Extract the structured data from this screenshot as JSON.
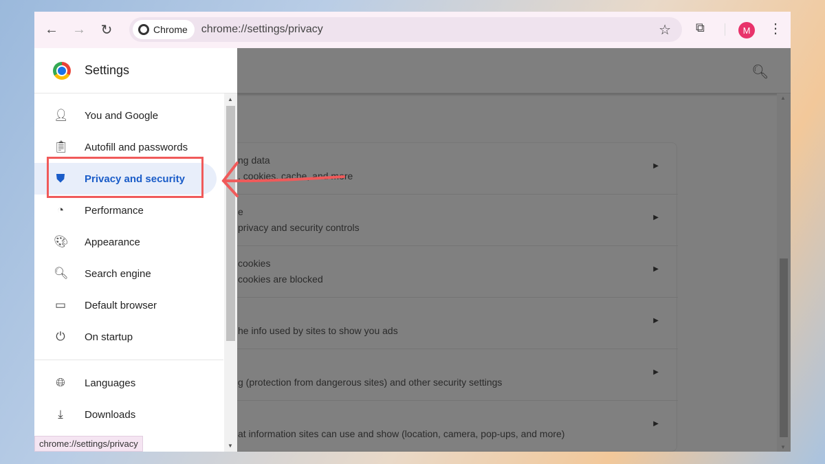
{
  "browser": {
    "chip_label": "Chrome",
    "url": "chrome://settings/privacy",
    "avatar_letter": "M",
    "status_url": "chrome://settings/privacy"
  },
  "sidebar": {
    "title": "Settings",
    "items": [
      {
        "label": "You and Google",
        "icon": "person-icon"
      },
      {
        "label": "Autofill and passwords",
        "icon": "clipboard-icon"
      },
      {
        "label": "Privacy and security",
        "icon": "shield-icon",
        "active": true
      },
      {
        "label": "Performance",
        "icon": "speedometer-icon"
      },
      {
        "label": "Appearance",
        "icon": "palette-icon"
      },
      {
        "label": "Search engine",
        "icon": "search-icon"
      },
      {
        "label": "Default browser",
        "icon": "browser-icon"
      },
      {
        "label": "On startup",
        "icon": "power-icon"
      },
      {
        "label": "Languages",
        "icon": "globe-icon"
      },
      {
        "label": "Downloads",
        "icon": "download-icon"
      }
    ]
  },
  "main": {
    "rows": [
      {
        "title": "ng data",
        "subtitle": ", cookies, cache, and more"
      },
      {
        "title": "e",
        "subtitle": "privacy and security controls"
      },
      {
        "title": "cookies",
        "subtitle": "cookies are blocked"
      },
      {
        "title": "",
        "subtitle": "he info used by sites to show you ads"
      },
      {
        "title": "",
        "subtitle": "g (protection from dangerous sites) and other security settings"
      },
      {
        "title": "",
        "subtitle": "at information sites can use and show (location, camera, pop-ups, and more)"
      }
    ]
  },
  "colors": {
    "highlight": "#f05a5a",
    "active": "#1a5cc8"
  }
}
